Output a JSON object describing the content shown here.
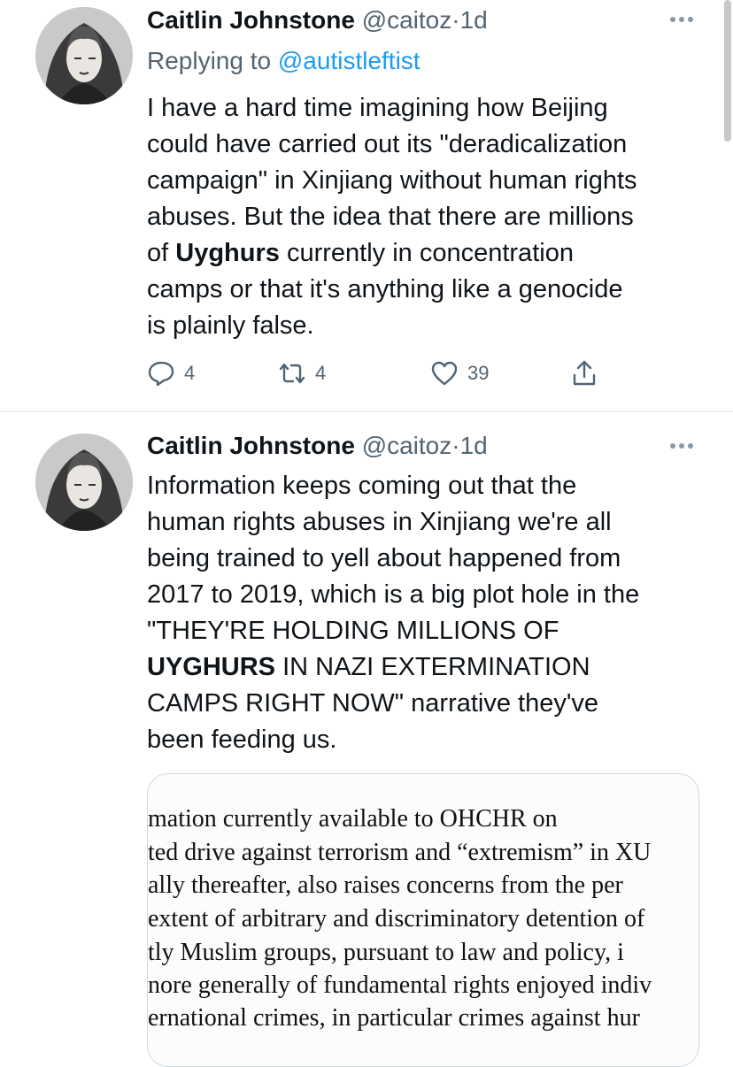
{
  "tweets": [
    {
      "author_name": "Caitlin Johnstone",
      "handle": "@caitoz",
      "separator": "·",
      "time": "1d",
      "replying_prefix": "Replying to ",
      "replying_handle": "@autistleftist",
      "body_parts": [
        "I have a hard time imagining how Beijing",
        "could have carried out its \"deradicalization",
        "campaign\" in Xinjiang without human rights",
        "abuses. But the idea that there are millions",
        "of ",
        "Uyghurs",
        " currently in concentration",
        "camps or that it's anything like a genocide",
        "is plainly false."
      ],
      "counts": {
        "replies": "4",
        "retweets": "4",
        "likes": "39"
      }
    },
    {
      "author_name": "Caitlin Johnstone",
      "handle": "@caitoz",
      "separator": "·",
      "time": "1d",
      "body_parts": [
        "Information keeps coming out that the",
        "human rights abuses in Xinjiang we're all",
        "being trained to yell about happened from",
        "2017 to 2019, which is a big plot hole in the",
        "\"THEY'RE HOLDING MILLIONS OF",
        "UYGHURS",
        " IN NAZI EXTERMINATION",
        "CAMPS RIGHT NOW\" narrative they've",
        "been feeding us."
      ],
      "document_lines": [
        "mation  currently  available  to  OHCHR  on",
        "ted drive against terrorism and “extremism” in XU",
        "ally  thereafter,  also raises concerns  from  the  per",
        " extent of arbitrary and discriminatory detention of",
        "tly  Muslim  groups,  pursuant  to  law  and  policy,  i",
        "nore generally of fundamental rights enjoyed indiv",
        "ernational crimes, in particular crimes against hur"
      ]
    }
  ],
  "icons": {
    "more": "more-icon",
    "reply": "reply-icon",
    "retweet": "retweet-icon",
    "like": "heart-icon",
    "share": "share-icon"
  },
  "colors": {
    "text": "#0f1419",
    "muted": "#536471",
    "link": "#1d9bf0",
    "divider": "#eff3f4"
  }
}
